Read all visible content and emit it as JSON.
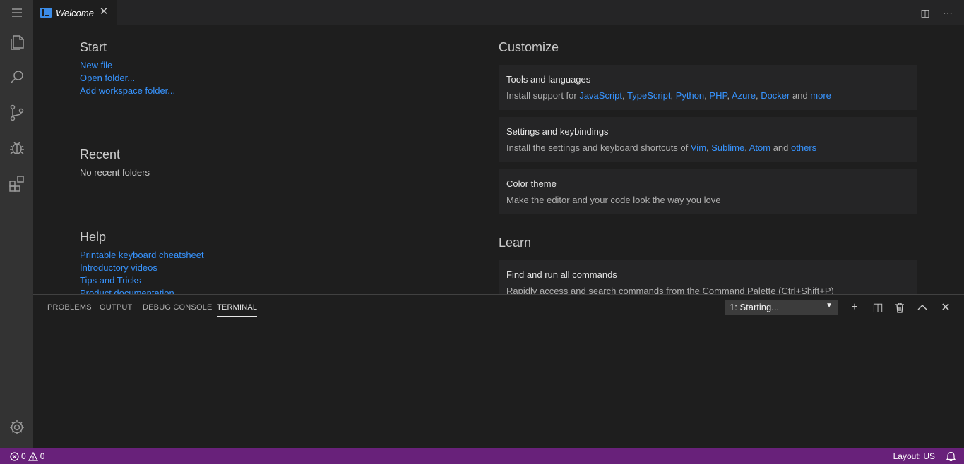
{
  "tab": {
    "title": "Welcome",
    "close": "✕"
  },
  "editor_actions": {
    "split": "◫",
    "more": "⋯"
  },
  "welcome": {
    "start": {
      "title": "Start",
      "links": [
        "New file",
        "Open folder...",
        "Add workspace folder..."
      ]
    },
    "recent": {
      "title": "Recent",
      "text": "No recent folders"
    },
    "help": {
      "title": "Help",
      "links": [
        "Printable keyboard cheatsheet",
        "Introductory videos",
        "Tips and Tricks",
        "Product documentation"
      ]
    },
    "customize": {
      "title": "Customize",
      "cards": [
        {
          "title": "Tools and languages",
          "prefix": "Install support for ",
          "links": [
            "JavaScript",
            "TypeScript",
            "Python",
            "PHP",
            "Azure",
            "Docker"
          ],
          "conj": " and ",
          "last": "more"
        },
        {
          "title": "Settings and keybindings",
          "prefix": "Install the settings and keyboard shortcuts of ",
          "links": [
            "Vim",
            "Sublime",
            "Atom"
          ],
          "conj": " and ",
          "last": "others"
        },
        {
          "title": "Color theme",
          "desc": "Make the editor and your code look the way you love"
        }
      ]
    },
    "learn": {
      "title": "Learn",
      "cards": [
        {
          "title": "Find and run all commands",
          "desc": "Rapidly access and search commands from the Command Palette (Ctrl+Shift+P)"
        }
      ]
    }
  },
  "panel": {
    "tabs": [
      "PROBLEMS",
      "OUTPUT",
      "DEBUG CONSOLE",
      "TERMINAL"
    ],
    "active_tab": "TERMINAL",
    "terminal_select": "1: Starting...",
    "icons": {
      "add": "+",
      "split": "◫",
      "trash": "🗑",
      "maximize": "︿",
      "close": "✕"
    }
  },
  "status": {
    "errors": "0",
    "warnings": "0",
    "layout": "Layout: US"
  },
  "colors": {
    "status_bg": "#68217a",
    "link": "#3794ff",
    "editor_bg": "#1e1e1e",
    "activity_bg": "#333333"
  }
}
